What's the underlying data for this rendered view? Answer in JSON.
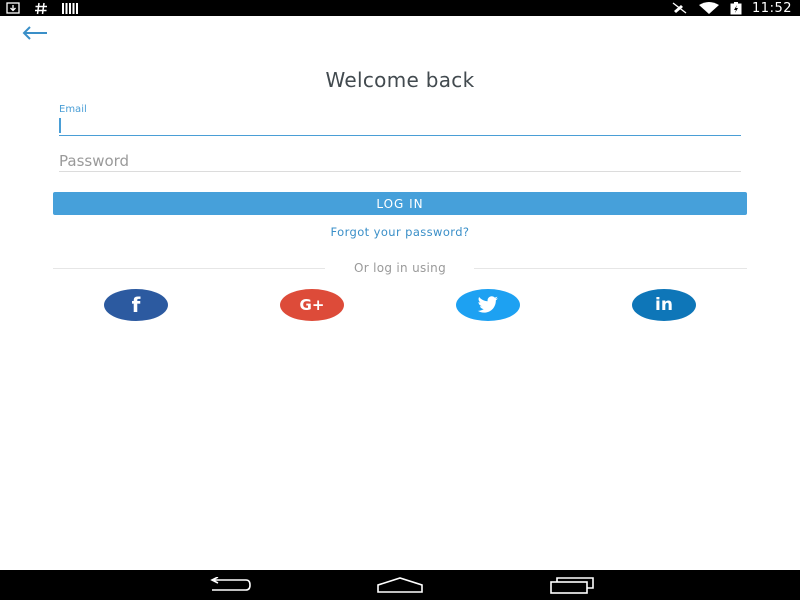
{
  "status_bar": {
    "time": "11:52",
    "left_icons": [
      "download-icon",
      "hash-icon",
      "barcode-icon"
    ],
    "right_icons": [
      "mute-icon",
      "wifi-icon",
      "battery-charging-icon"
    ]
  },
  "header": {
    "back_icon": "arrow-left-icon"
  },
  "login_form": {
    "title": "Welcome back",
    "email_label": "Email",
    "email_value": "",
    "password_placeholder": "Password",
    "password_value": "",
    "login_button_label": "LOG IN",
    "forgot_password_label": "Forgot your password?"
  },
  "social": {
    "divider_label": "Or log in using",
    "buttons": [
      {
        "name": "facebook",
        "glyph": "f",
        "icon": "facebook-icon",
        "color": "#2c5aa0"
      },
      {
        "name": "google-plus",
        "glyph": "G+",
        "icon": "google-plus-icon",
        "color": "#dd4b39"
      },
      {
        "name": "twitter",
        "glyph": "",
        "icon": "twitter-icon",
        "color": "#1da1f2"
      },
      {
        "name": "linkedin",
        "glyph": "in",
        "icon": "linkedin-icon",
        "color": "#0e76b8"
      }
    ]
  },
  "nav_bar": {
    "icons": [
      "nav-back-icon",
      "nav-home-icon",
      "nav-recents-icon"
    ]
  },
  "colors": {
    "accent": "#46a0da",
    "link": "#3a8fc8",
    "title": "#424a4f"
  }
}
